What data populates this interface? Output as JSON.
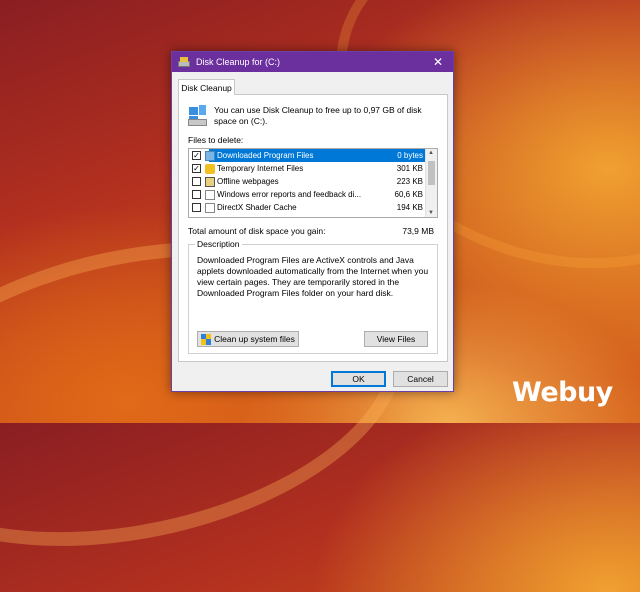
{
  "window": {
    "title": "Disk Cleanup for  (C:)"
  },
  "tabs": [
    "Disk Cleanup"
  ],
  "info_text": "You can use Disk Cleanup to free up to 0,97 GB of disk space on  (C:).",
  "files_label": "Files to delete:",
  "files": [
    {
      "name": "Downloaded Program Files",
      "size": "0 bytes",
      "checked": true,
      "selected": true
    },
    {
      "name": "Temporary Internet Files",
      "size": "301 KB",
      "checked": true,
      "selected": false
    },
    {
      "name": "Offline webpages",
      "size": "223 KB",
      "checked": false,
      "selected": false
    },
    {
      "name": "Windows error reports and feedback di...",
      "size": "60,6 KB",
      "checked": false,
      "selected": false
    },
    {
      "name": "DirectX Shader Cache",
      "size": "194 KB",
      "checked": false,
      "selected": false
    }
  ],
  "total": {
    "label": "Total amount of disk space you gain:",
    "value": "73,9 MB"
  },
  "description": {
    "legend": "Description",
    "text": "Downloaded Program Files are ActiveX controls and Java applets downloaded automatically from the Internet when you view certain pages. They are temporarily stored in the Downloaded Program Files folder on your hard disk."
  },
  "buttons": {
    "clean_system": "Clean up system files",
    "view_files": "View Files",
    "ok": "OK",
    "cancel": "Cancel"
  },
  "watermark": "Webuy",
  "colors": {
    "titlebar": "#6b2f9e",
    "selection": "#0078d7"
  }
}
